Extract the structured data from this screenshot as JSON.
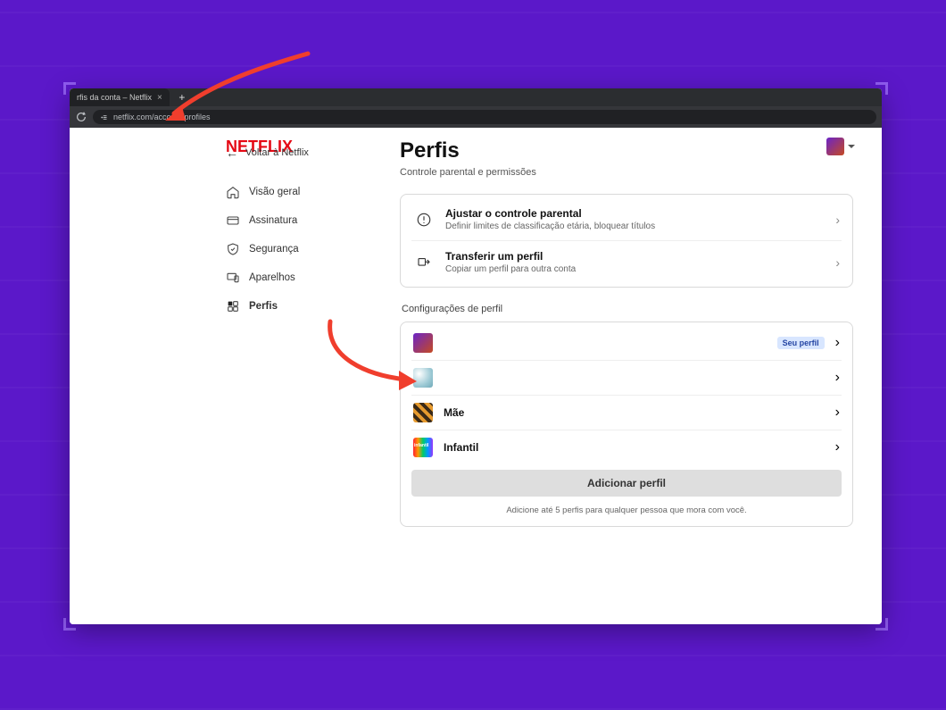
{
  "browser": {
    "tab_title": "rfis da conta – Netflix",
    "url": "netflix.com/account/profiles"
  },
  "header": {
    "logo_text": "NETFLIX"
  },
  "sidebar": {
    "back_label": "Voltar à Netflix",
    "items": [
      {
        "label": "Visão geral",
        "icon": "home-icon"
      },
      {
        "label": "Assinatura",
        "icon": "card-icon"
      },
      {
        "label": "Segurança",
        "icon": "shield-icon"
      },
      {
        "label": "Aparelhos",
        "icon": "devices-icon"
      },
      {
        "label": "Perfis",
        "icon": "profiles-icon"
      }
    ],
    "active_index": 4
  },
  "main": {
    "title": "Perfis",
    "subtitle": "Controle parental e permissões",
    "control_rows": [
      {
        "title": "Ajustar o controle parental",
        "desc": "Definir limites de classificação etária, bloquear títulos",
        "icon": "warning-icon"
      },
      {
        "title": "Transferir um perfil",
        "desc": "Copiar um perfil para outra conta",
        "icon": "transfer-icon"
      }
    ],
    "profiles_section_label": "Configurações de perfil",
    "profiles": [
      {
        "name": "",
        "badge": "Seu perfil",
        "avatar_class": "av1"
      },
      {
        "name": "",
        "badge": "",
        "avatar_class": "av2"
      },
      {
        "name": "Mãe",
        "badge": "",
        "avatar_class": "av3"
      },
      {
        "name": "Infantil",
        "badge": "",
        "avatar_class": "av4"
      }
    ],
    "add_button_label": "Adicionar perfil",
    "footer_hint": "Adicione até 5 perfis para qualquer pessoa que mora com você."
  },
  "colors": {
    "accent_red": "#e50914",
    "annotation_red": "#f03e2d",
    "background_purple": "#5b18c9"
  }
}
